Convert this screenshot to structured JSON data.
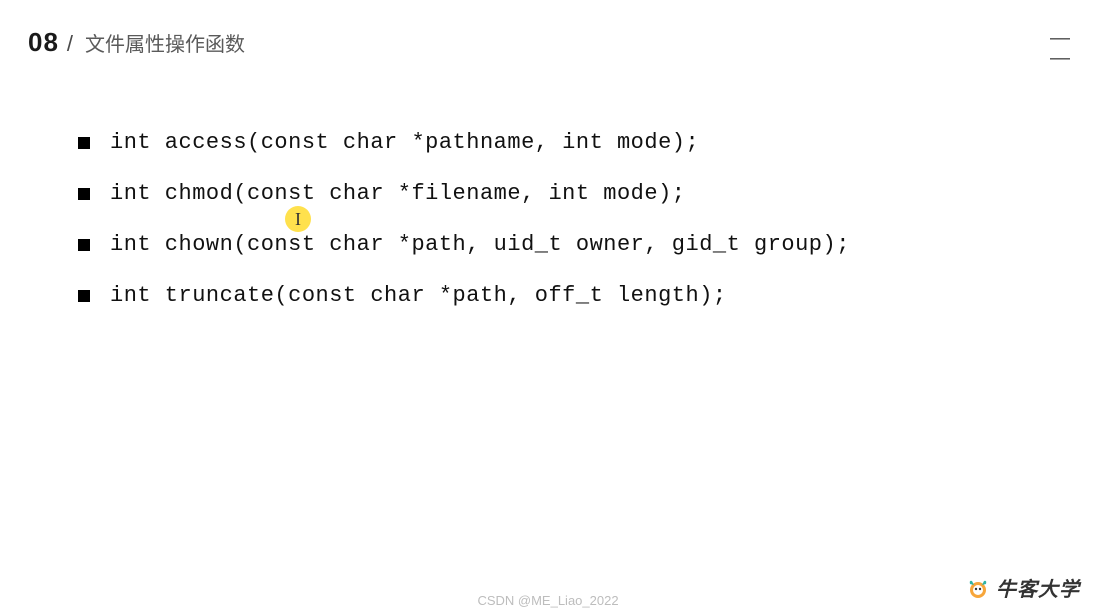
{
  "header": {
    "number": "08",
    "slash": "/",
    "title": "文件属性操作函数"
  },
  "bullets": [
    "int access(const char *pathname, int mode);",
    "int chmod(const char *filename, int mode);",
    "int chown(const char *path, uid_t owner, gid_t group);",
    "int truncate(const char *path, off_t length);"
  ],
  "watermark": "CSDN @ME_Liao_2022",
  "brand": {
    "name": "牛客大学"
  }
}
